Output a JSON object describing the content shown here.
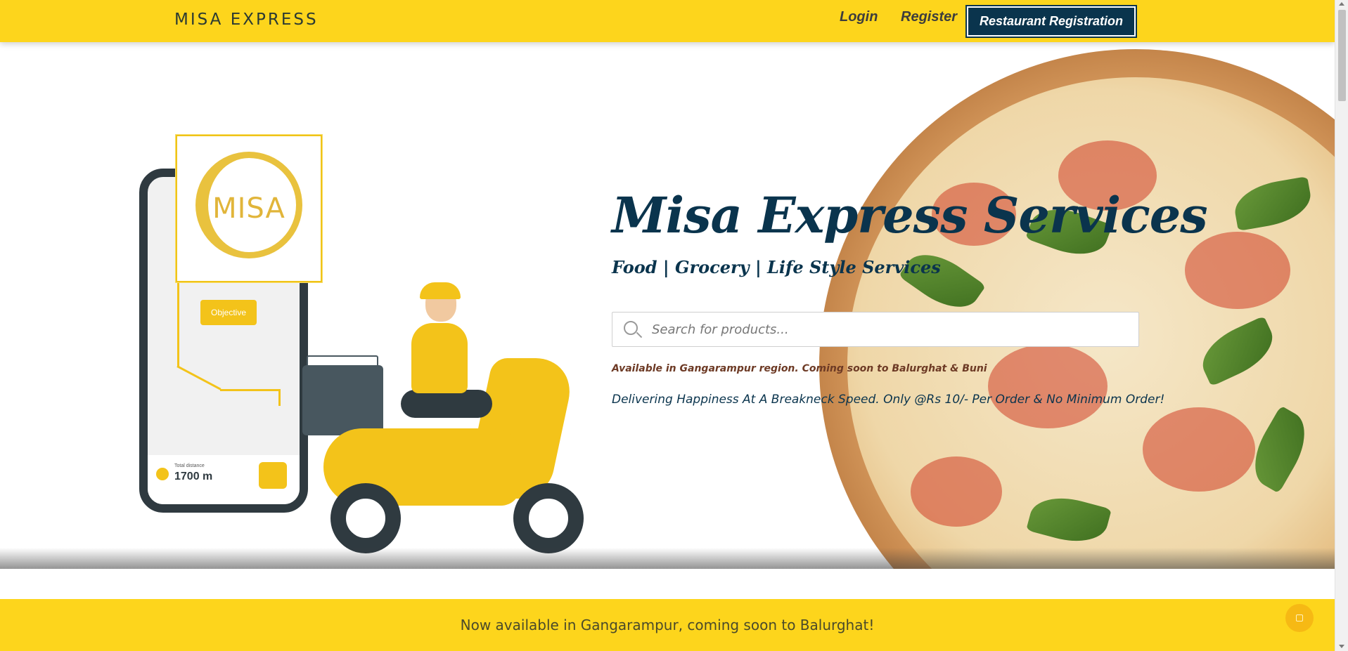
{
  "header": {
    "brand": "MISA EXPRESS",
    "login": "Login",
    "register": "Register",
    "restaurant_registration": "Restaurant Registration"
  },
  "hero": {
    "title": "Misa Express Services",
    "subtitle": "Food | Grocery | Life Style Services",
    "search_placeholder": "Search for products...",
    "availability": "Available in Gangarampur region. Coming soon to Balurghat & Buni",
    "tagline": "Delivering Happiness At A Breakneck Speed. Only @Rs 10/- Per Order & No Minimum Order!"
  },
  "illustration": {
    "logo_text": "MISA",
    "objective_label": "Objective",
    "distance_label": "Total distance",
    "distance_value": "1700 m"
  },
  "announcement": {
    "text": "Now available in Gangarampur, coming soon to Balurghat!"
  },
  "colors": {
    "brand_yellow": "#fdd51c",
    "navy": "#0a344d",
    "availability_brown": "#6d3a25"
  },
  "icons": {
    "search": "search-icon",
    "chat": "chat-icon"
  }
}
